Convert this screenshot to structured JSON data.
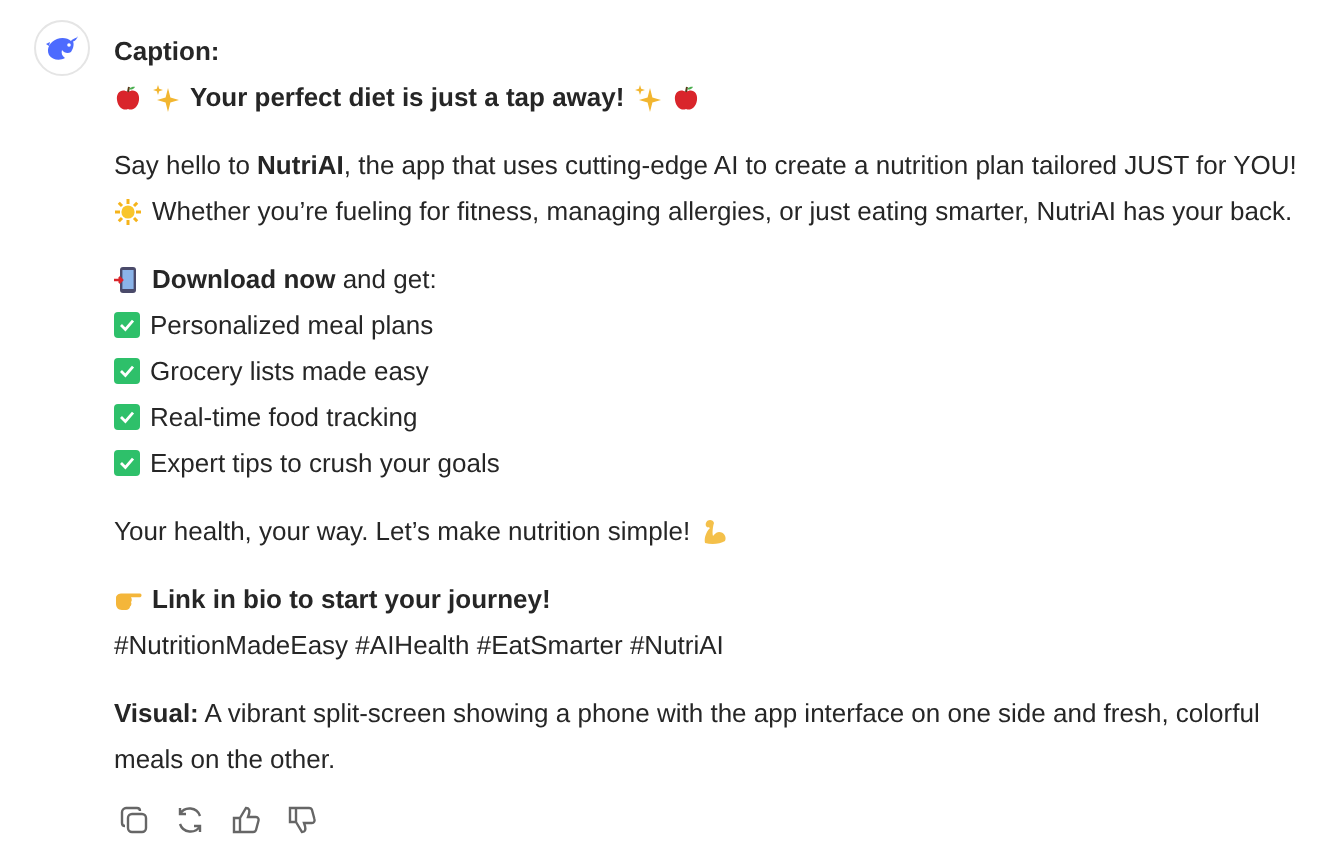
{
  "message": {
    "heading": "Caption:",
    "title": "Your perfect diet is just a tap away!",
    "intro": "Say hello to **NutriAI**, the app that uses cutting-edge AI to create a nutrition plan tailored JUST for YOU!",
    "intro_2": "Whether you’re fueling for fitness, managing allergies, or just eating smarter, NutriAI has your back.",
    "download": "**Download now** and get:",
    "features": [
      {
        "label": "Personalized meal plans",
        "checked": true
      },
      {
        "label": "Grocery lists made easy",
        "checked": true
      },
      {
        "label": "Real-time food tracking",
        "checked": true
      },
      {
        "label": "Expert tips to crush your goals",
        "checked": true
      }
    ],
    "closing": "Your health, your way. Let’s make nutrition simple!",
    "cta": "Link in bio to start your journey!",
    "hashtags": "#NutritionMadeEasy #AIHealth #EatSmarter #NutriAI",
    "visual": "**Visual:** A vibrant split-screen showing a phone with the app interface on one side and fresh, colorful meals on the other."
  }
}
